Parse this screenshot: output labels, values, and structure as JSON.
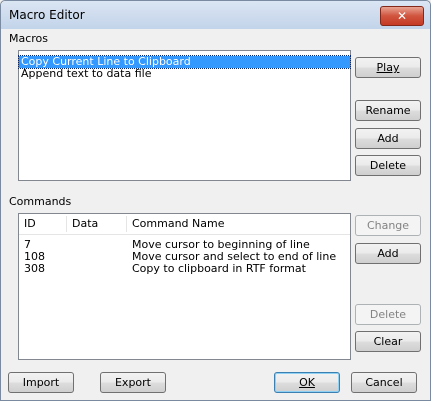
{
  "window": {
    "title": "Macro  Editor"
  },
  "macros": {
    "label": "Macros",
    "items": [
      {
        "label": "Copy Current Line to Clipboard",
        "selected": true
      },
      {
        "label": "Append text to data file",
        "selected": false
      }
    ],
    "buttons": {
      "play": "Play",
      "rename": "Rename",
      "add": "Add",
      "delete": "Delete"
    }
  },
  "commands": {
    "label": "Commands",
    "columns": [
      "ID",
      "Data",
      "Command Name"
    ],
    "rows": [
      {
        "id": "7",
        "data": "",
        "name": "Move cursor to beginning of line"
      },
      {
        "id": "108",
        "data": "",
        "name": "Move cursor and select to end of line"
      },
      {
        "id": "308",
        "data": "",
        "name": "Copy to clipboard in RTF format"
      }
    ],
    "buttons": {
      "change": "Change",
      "add": "Add",
      "delete": "Delete",
      "clear": "Clear"
    }
  },
  "footer": {
    "import": "Import",
    "export": "Export",
    "ok": "OK",
    "cancel": "Cancel"
  },
  "colors": {
    "selection": "#3399ff",
    "close_button": "#c53a24"
  }
}
